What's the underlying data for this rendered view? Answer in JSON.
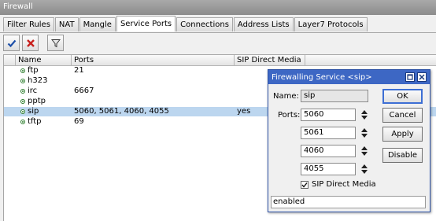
{
  "window": {
    "title": "Firewall"
  },
  "tabs": [
    {
      "label": "Filter Rules"
    },
    {
      "label": "NAT"
    },
    {
      "label": "Mangle"
    },
    {
      "label": "Service Ports",
      "active": true
    },
    {
      "label": "Connections"
    },
    {
      "label": "Address Lists"
    },
    {
      "label": "Layer7 Protocols"
    }
  ],
  "toolbar": {
    "icons": [
      "checkmark-icon",
      "close-icon",
      "filter-icon"
    ]
  },
  "table": {
    "columns": [
      "Name",
      "Ports",
      "SIP Direct Media"
    ],
    "rows": [
      {
        "name": "ftp",
        "ports": "21",
        "sip_direct_media": ""
      },
      {
        "name": "h323",
        "ports": "",
        "sip_direct_media": ""
      },
      {
        "name": "irc",
        "ports": "6667",
        "sip_direct_media": ""
      },
      {
        "name": "pptp",
        "ports": "",
        "sip_direct_media": ""
      },
      {
        "name": "sip",
        "ports": "5060, 5061, 4060, 4055",
        "sip_direct_media": "yes",
        "selected": true
      },
      {
        "name": "tftp",
        "ports": "69",
        "sip_direct_media": ""
      }
    ]
  },
  "dialog": {
    "title": "Firewalling Service <sip>",
    "name_label": "Name:",
    "name_value": "sip",
    "ports_label": "Ports:",
    "ports": [
      "5060",
      "5061",
      "4060",
      "4055"
    ],
    "sip_direct_media_label": "SIP Direct Media",
    "sip_direct_media_checked": true,
    "buttons": {
      "ok": "OK",
      "cancel": "Cancel",
      "apply": "Apply",
      "disable": "Disable"
    },
    "status": "enabled"
  },
  "colors": {
    "accent": "#3d67c4",
    "selection": "#bcd6ef",
    "enabled_dot": "#2c7d2c"
  }
}
